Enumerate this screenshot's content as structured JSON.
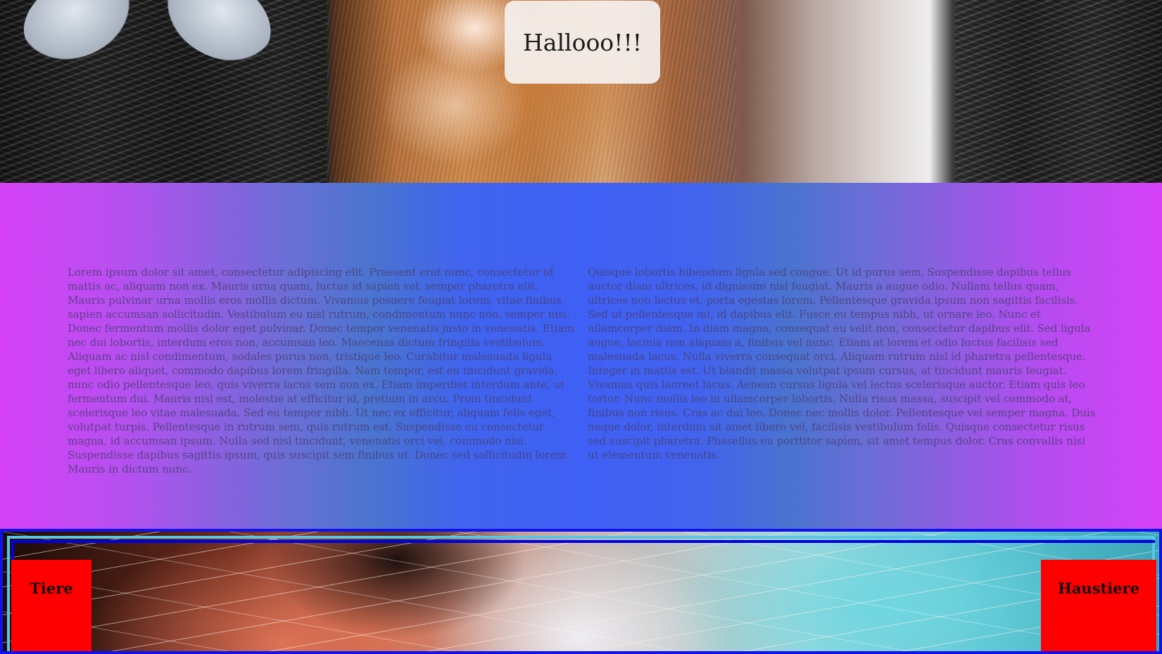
{
  "hero": {
    "image": "cat-photo",
    "greeting": "Hallooo!!!"
  },
  "main": {
    "column_left": "Lorem ipsum dolor sit amet, consectetur adipiscing elit. Praesent erat nunc, consectetur id mattis ac, aliquam non ex. Mauris urna quam, luctus id sapien vel, semper pharetra elit. Mauris pulvinar urna mollis eros mollis dictum. Vivamus posuere feugiat lorem, vitae finibus sapien accumsan sollicitudin. Vestibulum eu nisl rutrum, condimentum nunc non, semper nisi. Donec fermentum mollis dolor eget pulvinar. Donec tempor venenatis justo in venenatis. Etiam nec dui lobortis, interdum eros non, accumsan leo. Maecenas dictum fringilla vestibulum. Aliquam ac nisl condimentum, sodales purus non, tristique leo. Curabitur malesuada ligula eget libero aliquet, commodo dapibus lorem fringilla. Nam tempor, est eu tincidunt gravida, nunc odio pellentesque leo, quis viverra lacus sem non ex. Etiam imperdiet interdum ante, ut fermentum dui. Mauris nisl est, molestie at efficitur id, pretium in arcu. Proin tincidunt scelerisque leo vitae malesuada. Sed eu tempor nibh. Ut nec ex efficitur, aliquam felis eget, volutpat turpis. Pellentesque in rutrum sem, quis rutrum est. Suspendisse eu consectetur magna, id accumsan ipsum. Nulla sed nisl tincidunt, venenatis orci vel, commodo nisi. Suspendisse dapibus sagittis ipsum, quis suscipit sem finibus ut. Donec sed sollicitudin lorem. Mauris in dictum nunc.",
    "column_right": "Quisque lobortis bibendum ligula sed congue. Ut id purus sem. Suspendisse dapibus tellus auctor diam ultrices, id dignissim nisl feugiat. Mauris a augue odio. Nullam tellus quam, ultrices non lectus et, porta egestas lorem. Pellentesque gravida ipsum non sagittis facilisis. Sed ut pellentesque mi, id dapibus elit. Fusce eu tempus nibh, ut ornare leo. Nunc et ullamcorper diam. In diam magna, consequat eu velit non, consectetur dapibus elit. Sed ligula augue, lacinia non aliquam a, finibus vel nunc. Etiam at lorem et odio luctus facilisis sed malesuada lacus. Nulla viverra consequat orci. Aliquam rutrum nisl id pharetra pellentesque. Integer in mattis est. Ut blandit massa volutpat ipsum cursus, at tincidunt mauris feugiat. Vivamus quis laoreet lacus. Aenean cursus ligula vel lectus scelerisque auctor. Etiam quis leo tortor. Nunc mollis leo in ullamcorper lobortis. Nulla risus massa, suscipit vel commodo at, finibus non risus. Cras ac dui leo. Donec nec mollis dolor. Pellentesque vel semper magna. Duis neque dolor, interdum sit amet libero vel, facilisis vestibulum felis. Quisque consectetur risus sed suscipit pharetra. Phasellus eu porttitor sapien, sit amet tempus dolor. Cras convallis nisi ut elementum venenatis."
  },
  "nav": {
    "left_label": "Tiere",
    "right_label": "Haustiere",
    "background_image": "cat-closeup-photo"
  },
  "colors": {
    "gradient_edge": "#d641f7",
    "gradient_center": "#4064ee",
    "nav_button": "#ff0000",
    "frame_border": "#1111ee"
  }
}
